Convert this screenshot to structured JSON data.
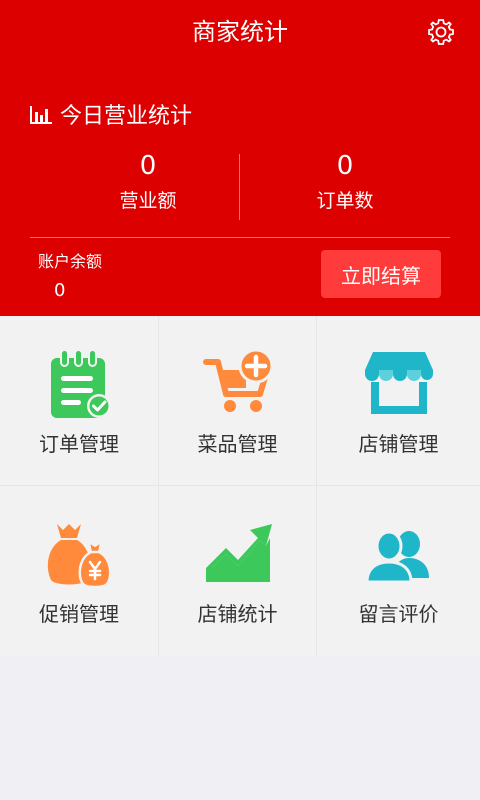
{
  "header": {
    "title": "商家统计",
    "settings_icon": "gear-icon"
  },
  "stats": {
    "title": "今日营业统计",
    "title_icon": "bar-chart-icon",
    "revenue": {
      "value": "0",
      "label": "营业额"
    },
    "orders": {
      "value": "0",
      "label": "订单数"
    },
    "balance": {
      "label": "账户余额",
      "value": "0"
    },
    "settle_label": "立即结算"
  },
  "menu": [
    {
      "label": "订单管理",
      "icon": "order-clipboard-icon",
      "color": "#3cc85a"
    },
    {
      "label": "菜品管理",
      "icon": "cart-add-icon",
      "color": "#ff8a3c"
    },
    {
      "label": "店铺管理",
      "icon": "store-icon",
      "color": "#1fb6c9"
    },
    {
      "label": "促销管理",
      "icon": "money-bag-icon",
      "color": "#ff8a3c"
    },
    {
      "label": "店铺统计",
      "icon": "trend-chart-icon",
      "color": "#3cc85a"
    },
    {
      "label": "留言评价",
      "icon": "users-icon",
      "color": "#1fb6c9"
    }
  ],
  "colors": {
    "primary": "#dc0000",
    "button": "#ff3b3b",
    "background": "#efeff4"
  }
}
